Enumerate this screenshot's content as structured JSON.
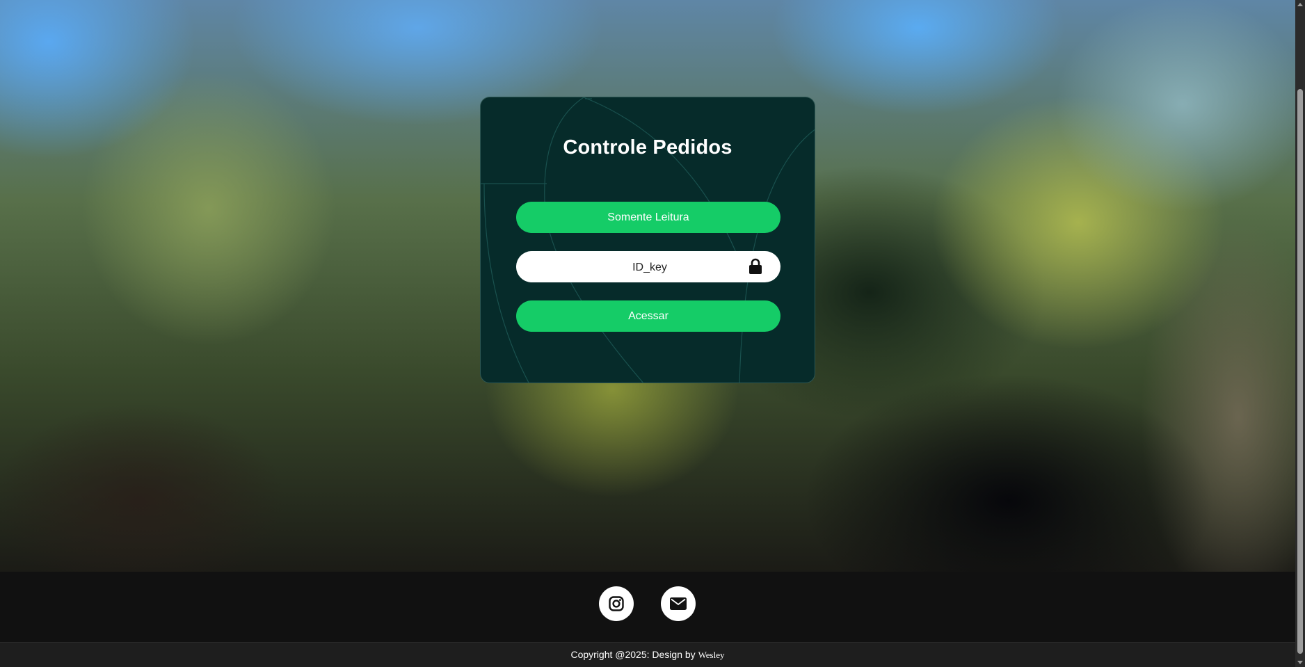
{
  "login_card": {
    "title": "Controle Pedidos",
    "read_only_label": "Somente Leitura",
    "id_key_placeholder": "ID_key",
    "access_label": "Acessar"
  },
  "footer": {
    "social": [
      {
        "name": "instagram",
        "icon": "instagram-icon"
      },
      {
        "name": "email",
        "icon": "envelope-icon"
      }
    ],
    "copyright_text": "Copyright @2025: Design by",
    "copyright_author": "Wesley"
  },
  "colors": {
    "card_bg": "#062b2a",
    "button_green": "#15cc67",
    "footer_bg": "#111111"
  }
}
